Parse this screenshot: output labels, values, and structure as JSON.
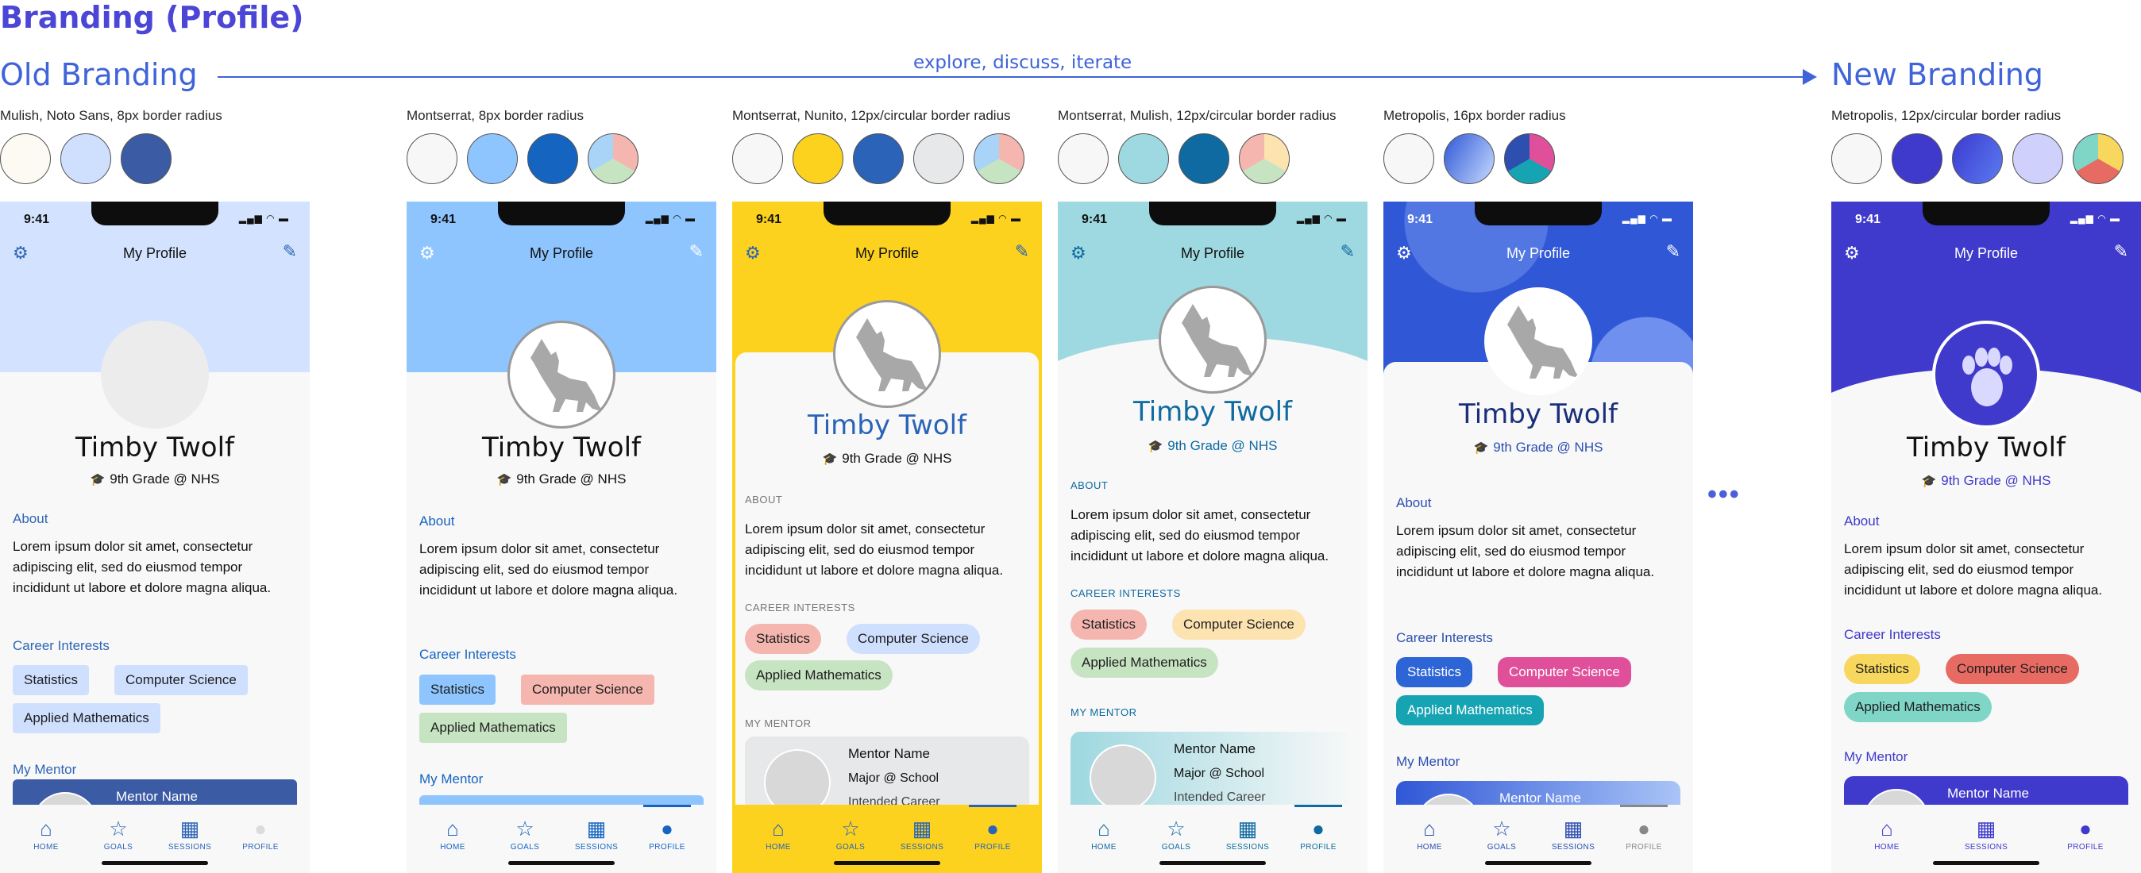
{
  "page_title": "Branding (Profile)",
  "old_branding_label": "Old Branding",
  "new_branding_label": "New Branding",
  "arrow_label": "explore, discuss, iterate",
  "more_indicator": "•••",
  "variants": [
    {
      "font_note": "Mulish, Noto Sans, 8px border radius",
      "swatches": [
        "#fdf9f3",
        "#cfe0ff",
        "#3b5ba5"
      ],
      "status_time": "9:41",
      "nav_title": "My Profile",
      "name": "Timby Twolf",
      "grade": "9th Grade @ NHS",
      "about_label": "About",
      "about_text": "Lorem ipsum dolor sit amet, consectetur adipiscing elit, sed do eiusmod tempor incididunt ut labore et dolore magna aliqua.",
      "career_label": "Career Interests",
      "chips": [
        "Statistics",
        "Computer Science",
        "Applied Mathematics"
      ],
      "mentor_label": "My Mentor",
      "mentor_name": "Mentor Name",
      "tabs": [
        "HOME",
        "GOALS",
        "SESSIONS",
        "PROFILE"
      ],
      "accent": "#2d65b5"
    },
    {
      "font_note": "Montserrat, 8px border radius",
      "swatches": [
        "#f7f7f7",
        "#8ec5ff",
        "#1565c0",
        "pie:#f4b6ae,#c7e4c2,#a9d4f7"
      ],
      "status_time": "9:41",
      "nav_title": "My Profile",
      "name": "Timby Twolf",
      "grade": "9th Grade @ NHS",
      "about_label": "About",
      "about_text": "Lorem ipsum dolor sit amet, consectetur adipiscing elit, sed do eiusmod tempor incididunt ut labore et dolore magna aliqua.",
      "career_label": "Career Interests",
      "chips": [
        "Statistics",
        "Computer Science",
        "Applied Mathematics"
      ],
      "mentor_label": "My Mentor",
      "tabs": [
        "HOME",
        "GOALS",
        "SESSIONS",
        "PROFILE"
      ],
      "accent": "#1565c0"
    },
    {
      "font_note": "Montserrat, Nunito, 12px/circular border radius",
      "swatches": [
        "#f7f7f7",
        "#fcd21e",
        "#2a63b8",
        "#e6e8ea",
        "pie:#f4b6ae,#c7e4c2,#a9d4f7"
      ],
      "status_time": "9:41",
      "nav_title": "My Profile",
      "name": "Timby Twolf",
      "grade": "9th Grade @ NHS",
      "about_label": "ABOUT",
      "about_text": "Lorem ipsum dolor sit amet, consectetur adipiscing elit, sed do eiusmod tempor incididunt ut labore et dolore magna aliqua.",
      "career_label": "CAREER INTERESTS",
      "chips": [
        "Statistics",
        "Computer Science",
        "Applied Mathematics"
      ],
      "mentor_label": "MY MENTOR",
      "mentor_name": "Mentor Name",
      "mentor_school": "Major @ School",
      "mentor_career": "Intended Career",
      "tabs": [
        "HOME",
        "GOALS",
        "SESSIONS",
        "PROFILE"
      ],
      "accent": "#2a63b8"
    },
    {
      "font_note": "Montserrat, Mulish, 12px/circular border radius",
      "swatches": [
        "#f7f7f7",
        "#9ed8e0",
        "#0e6aa0",
        "pie:#fde3b0,#c7e4c2,#f4b6ae"
      ],
      "status_time": "9:41",
      "nav_title": "My Profile",
      "name": "Timby Twolf",
      "grade": "9th Grade @ NHS",
      "about_label": "ABOUT",
      "about_text": "Lorem ipsum dolor sit amet, consectetur adipiscing elit, sed do eiusmod tempor incididunt ut labore et dolore magna aliqua.",
      "career_label": "CAREER INTERESTS",
      "chips": [
        "Statistics",
        "Computer Science",
        "Applied Mathematics"
      ],
      "mentor_label": "MY MENTOR",
      "mentor_name": "Mentor Name",
      "mentor_school": "Major @ School",
      "mentor_career": "Intended Career",
      "tabs": [
        "HOME",
        "GOALS",
        "SESSIONS",
        "PROFILE"
      ],
      "accent": "#0e6aa0"
    },
    {
      "font_note": "Metropolis, 16px border radius",
      "swatches": [
        "#f7f7f7",
        "grad:#3057d6,#c5dbff",
        "pie:#e0509a,#16a4b3,#2d4fb0"
      ],
      "status_time": "9:41",
      "nav_title": "My Profile",
      "name": "Timby Twolf",
      "grade": "9th Grade @ NHS",
      "about_label": "About",
      "about_text": "Lorem ipsum dolor sit amet, consectetur adipiscing elit, sed do eiusmod tempor incididunt ut labore et dolore magna aliqua.",
      "career_label": "Career Interests",
      "chips": [
        "Statistics",
        "Computer Science",
        "Applied Mathematics"
      ],
      "mentor_label": "My Mentor",
      "mentor_name": "Mentor Name",
      "tabs": [
        "HOME",
        "GOALS",
        "SESSIONS",
        "PROFILE"
      ],
      "accent": "#2d4fb0"
    },
    {
      "font_note": "Metropolis, 12px/circular border radius",
      "swatches": [
        "#f7f7f7",
        "#3f3acb",
        "grad:#3b3ad0,#5b7bf0",
        "#cfd0fb",
        "pie:#f7d75e,#e86b63,#7fd6c7"
      ],
      "status_time": "9:41",
      "nav_title": "My Profile",
      "name": "Timby Twolf",
      "grade": "9th Grade @ NHS",
      "about_label": "About",
      "about_text": "Lorem ipsum dolor sit amet, consectetur adipiscing elit, sed do eiusmod tempor incididunt ut labore et dolore magna aliqua.",
      "career_label": "Career Interests",
      "chips": [
        "Statistics",
        "Computer Science",
        "Applied Mathematics"
      ],
      "mentor_label": "My Mentor",
      "mentor_name": "Mentor Name",
      "tabs": [
        "HOME",
        "SESSIONS",
        "PROFILE"
      ],
      "accent": "#3f3acb"
    }
  ]
}
